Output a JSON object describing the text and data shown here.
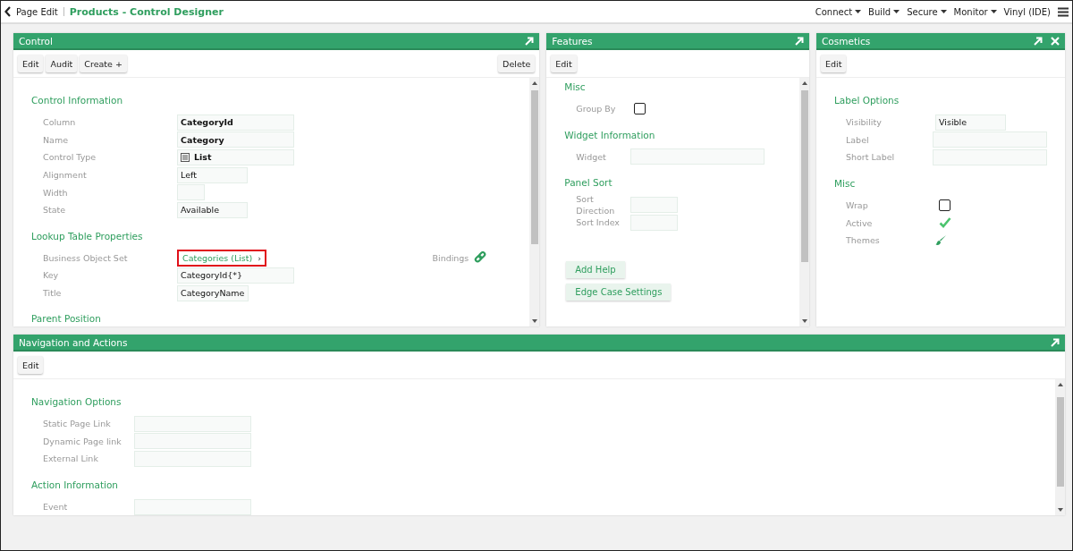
{
  "header": {
    "back_label": "Page Edit",
    "title": "Products - Control Designer",
    "menus": [
      {
        "label": "Connect",
        "dropdown": true
      },
      {
        "label": "Build",
        "dropdown": true
      },
      {
        "label": "Secure",
        "dropdown": true
      },
      {
        "label": "Monitor",
        "dropdown": true
      },
      {
        "label": "Vinyl (IDE)",
        "dropdown": false
      }
    ]
  },
  "panels": [
    {
      "title": "Control",
      "closable": false,
      "toolbar": [
        "Edit",
        "Audit",
        "Create +"
      ],
      "toolbar_right": [
        "Delete"
      ],
      "scroll": true,
      "sections": [
        {
          "title": "Control Information",
          "fields": [
            {
              "label": "Column",
              "kind": "text",
              "value": "CategoryId",
              "bold": true
            },
            {
              "label": "Name",
              "kind": "text",
              "value": "Category",
              "bold": true
            },
            {
              "label": "Control Type",
              "kind": "list",
              "value": "List",
              "bold": true
            },
            {
              "label": "Alignment",
              "kind": "text",
              "value": "Left",
              "bold": false
            },
            {
              "label": "Width",
              "kind": "text"
            },
            {
              "label": "State",
              "kind": "text",
              "value": "Available",
              "bold": false
            }
          ]
        },
        {
          "title": "Lookup Table Properties",
          "fields": [
            {
              "label": "Business Object Set",
              "kind": "link",
              "value": "Categories (List)",
              "arrow": "›",
              "highlighted": true,
              "aside": "Bindings"
            },
            {
              "label": "Key",
              "kind": "text",
              "value": "CategoryId{*}",
              "bold": false
            },
            {
              "label": "Title",
              "kind": "text",
              "value": "CategoryName",
              "bold": false
            }
          ]
        },
        {
          "title": "Parent Position"
        }
      ]
    },
    {
      "title": "Features",
      "closable": false,
      "toolbar": [
        "Edit"
      ],
      "scroll": true,
      "sections": [
        {
          "title": "Misc",
          "fields": [
            {
              "label": "Group By",
              "kind": "checkbox",
              "checked": false
            }
          ]
        },
        {
          "title": "Widget Information",
          "fields": [
            {
              "label": "Widget",
              "kind": "text"
            }
          ]
        },
        {
          "title": "Panel Sort",
          "fields": [
            {
              "label": "Sort Direction",
              "kind": "text"
            },
            {
              "label": "Sort Index",
              "kind": "text"
            }
          ]
        }
      ],
      "actions": [
        "Add Help",
        "Edge Case Settings"
      ]
    },
    {
      "title": "Cosmetics",
      "closable": true,
      "toolbar": [
        "Edit"
      ],
      "scroll": false,
      "sections": [
        {
          "title": "Label Options",
          "fields": [
            {
              "label": "Visibility",
              "kind": "text",
              "value": "Visible",
              "bold": false
            },
            {
              "label": "Label",
              "kind": "text"
            },
            {
              "label": "Short Label",
              "kind": "text"
            }
          ]
        },
        {
          "title": "Misc",
          "fields": [
            {
              "label": "Wrap",
              "kind": "checkbox",
              "checked": false
            },
            {
              "label": "Active",
              "kind": "checkbox",
              "checked": true
            },
            {
              "label": "Themes",
              "kind": "brush"
            }
          ]
        }
      ]
    },
    {
      "title": "Navigation and Actions",
      "closable": false,
      "toolbar": [
        "Edit"
      ],
      "scroll": true,
      "sections": [
        {
          "title": "Navigation Options",
          "fields": [
            {
              "label": "Static Page Link",
              "kind": "text"
            },
            {
              "label": "Dynamic Page link",
              "kind": "text"
            },
            {
              "label": "External Link",
              "kind": "text"
            }
          ]
        },
        {
          "title": "Action Information",
          "fields": [
            {
              "label": "Event",
              "kind": "text"
            }
          ]
        }
      ]
    }
  ]
}
